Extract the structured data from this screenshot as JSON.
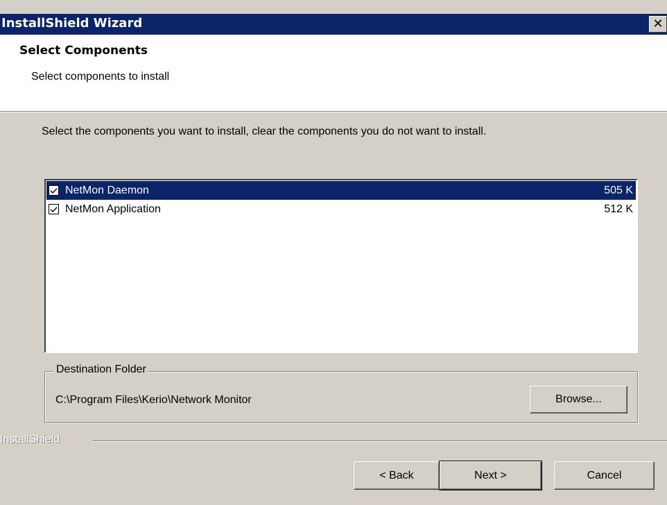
{
  "window": {
    "title": "InstallShield Wizard",
    "close_label": "✕"
  },
  "header": {
    "title": "Select Components",
    "subtitle": "Select components to install"
  },
  "instruction": "Select the components you want to install, clear the components you do not want to install.",
  "components": [
    {
      "label": "NetMon Daemon",
      "size": "505 K",
      "checked": true,
      "selected": true
    },
    {
      "label": "NetMon Application",
      "size": "512 K",
      "checked": true,
      "selected": false
    }
  ],
  "destination": {
    "legend": "Destination Folder",
    "path": "C:\\Program Files\\Kerio\\Network Monitor",
    "browse_label": "Browse..."
  },
  "brand": "InstallShield",
  "buttons": {
    "back": "< Back",
    "next": "Next >",
    "cancel": "Cancel"
  },
  "colors": {
    "titlebar": "#0a246a",
    "selection": "#0a246a",
    "face": "#d4d0c8"
  }
}
